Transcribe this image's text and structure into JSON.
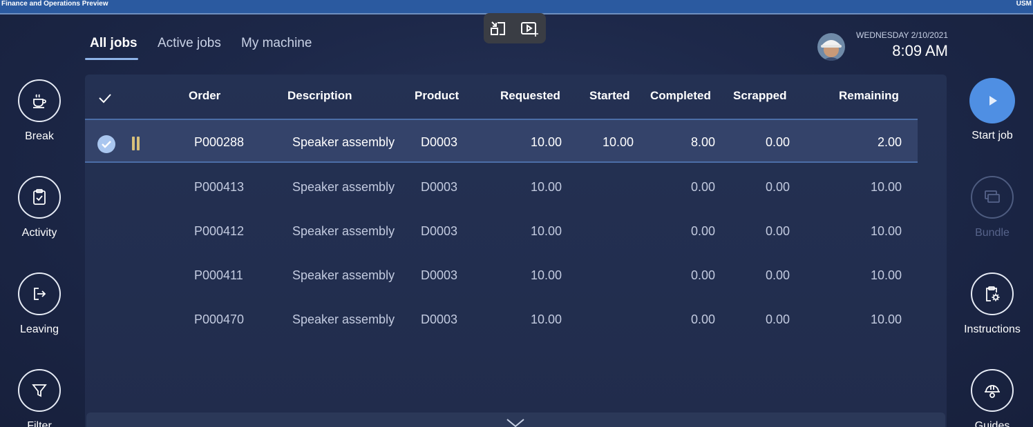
{
  "topbar": {
    "title": "Finance and Operations Preview",
    "user": "USM"
  },
  "video_controls": {
    "icons": [
      "collapse-window-icon",
      "video-sparkle-icon"
    ]
  },
  "tabs": [
    {
      "label": "All jobs",
      "active": true
    },
    {
      "label": "Active jobs",
      "active": false
    },
    {
      "label": "My machine",
      "active": false
    }
  ],
  "header": {
    "date": "WEDNESDAY 2/10/2021",
    "time": "8:09 AM"
  },
  "left_actions": [
    {
      "label": "Break",
      "icon": "coffee-cup-icon"
    },
    {
      "label": "Activity",
      "icon": "clipboard-check-icon"
    },
    {
      "label": "Leaving",
      "icon": "sign-out-icon"
    },
    {
      "label": "Filter",
      "icon": "funnel-icon"
    }
  ],
  "right_actions": [
    {
      "label": "Start job",
      "icon": "play-icon",
      "enabled": true
    },
    {
      "label": "Bundle",
      "icon": "stack-icon",
      "enabled": false
    },
    {
      "label": "Instructions",
      "icon": "clipboard-gear-icon",
      "enabled": true
    },
    {
      "label": "Guides",
      "icon": "hardhat-icon",
      "enabled": true
    }
  ],
  "grid": {
    "columns": [
      "Order",
      "Description",
      "Product",
      "Requested",
      "Started",
      "Completed",
      "Scrapped",
      "Remaining"
    ],
    "rows": [
      {
        "order": "P000288",
        "description": "Speaker assembly",
        "product": "D0003",
        "requested": "10.00",
        "started": "10.00",
        "completed": "8.00",
        "scrapped": "0.00",
        "remaining": "2.00",
        "selected": true,
        "status": "paused"
      },
      {
        "order": "P000413",
        "description": "Speaker assembly",
        "product": "D0003",
        "requested": "10.00",
        "started": "",
        "completed": "0.00",
        "scrapped": "0.00",
        "remaining": "10.00",
        "selected": false
      },
      {
        "order": "P000412",
        "description": "Speaker assembly",
        "product": "D0003",
        "requested": "10.00",
        "started": "",
        "completed": "0.00",
        "scrapped": "0.00",
        "remaining": "10.00",
        "selected": false
      },
      {
        "order": "P000411",
        "description": "Speaker assembly",
        "product": "D0003",
        "requested": "10.00",
        "started": "",
        "completed": "0.00",
        "scrapped": "0.00",
        "remaining": "10.00",
        "selected": false
      },
      {
        "order": "P000470",
        "description": "Speaker assembly",
        "product": "D0003",
        "requested": "10.00",
        "started": "",
        "completed": "0.00",
        "scrapped": "0.00",
        "remaining": "10.00",
        "selected": false
      }
    ]
  },
  "colors": {
    "accent": "#4f8fe3",
    "topbar": "#2b5aa0",
    "background": "#1d2849",
    "selected_row": "#34436a",
    "pause": "#d7c07a"
  }
}
